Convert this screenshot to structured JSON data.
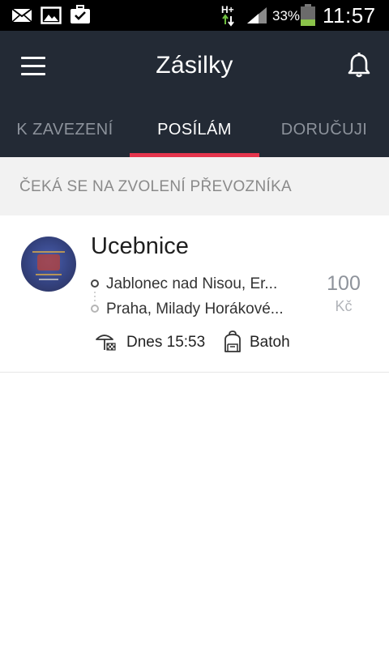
{
  "status_bar": {
    "icons": [
      "mail-icon",
      "image-icon",
      "briefcase-check-icon",
      "network-hplus-icon",
      "signal-icon",
      "battery-icon"
    ],
    "network_type": "H+",
    "battery_percent": "33%",
    "battery_level": 0.33,
    "battery_color": "#8bc34a",
    "time": "11:57"
  },
  "app_bar": {
    "title": "Zásilky",
    "background": "#232a35",
    "menu_icon": "hamburger-menu-icon",
    "notification_icon": "bell-icon"
  },
  "tabs": [
    {
      "label": "K ZAVEZENÍ",
      "active": false
    },
    {
      "label": "POSÍLÁM",
      "active": true
    },
    {
      "label": "DORUČUJI",
      "active": false
    }
  ],
  "accent_color": "#e5354d",
  "section": {
    "header": "ČEKÁ SE NA ZVOLENÍ PŘEVOZNÍKA"
  },
  "shipments": [
    {
      "title": "Ucebnice",
      "from": "Jablonec nad Nisou, Er...",
      "to": "Praha, Milady Horákové...",
      "price": "100",
      "currency": "Kč",
      "time_label": "Dnes 15:53",
      "size_label": "Batoh",
      "time_icon": "flag-pickup-icon",
      "size_icon": "backpack-icon"
    }
  ]
}
